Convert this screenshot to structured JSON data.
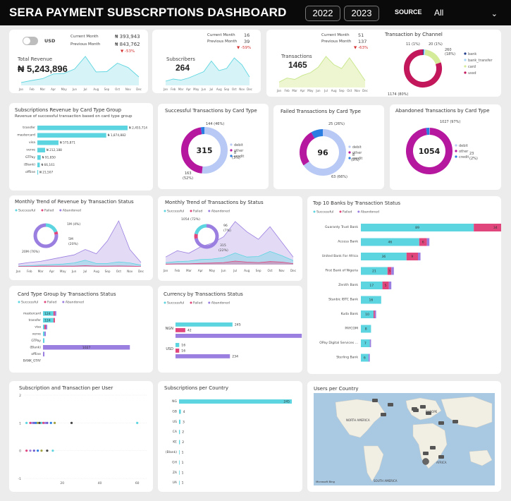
{
  "header": {
    "title": "SERA PAYMENT SUBSCRPTIONS DASHBOARD",
    "years": [
      "2022",
      "2023"
    ],
    "source_label": "SOURCE",
    "source_value": "All"
  },
  "kpis": {
    "currency_toggle_label": "USD",
    "revenue": {
      "label": "Total Revenue",
      "value": "₦ 5,243,896",
      "current_label": "Current Month",
      "current_value": "₦ 393,943",
      "previous_label": "Previous Month",
      "previous_value": "₦ 843,762",
      "change": "▼ -53%"
    },
    "subscribers": {
      "label": "Subscribers",
      "value": "264",
      "current_label": "Current Month",
      "current_value": "16",
      "previous_label": "Previous Month",
      "previous_value": "39",
      "change": "▼ -59%"
    },
    "transactions": {
      "label": "Transactions",
      "value": "1465",
      "current_label": "Current Month",
      "current_value": "51",
      "previous_label": "Previous Month",
      "previous_value": "137",
      "change": "▼ -63%"
    },
    "months": [
      "Jan",
      "Feb",
      "Mar",
      "Apr",
      "May",
      "Jun",
      "Jul",
      "Aug",
      "Sep",
      "Oct",
      "Nov",
      "Dec"
    ]
  },
  "colors": {
    "successful": "#5dd5e0",
    "failed": "#e0457b",
    "abandoned": "#9b7fe0",
    "bank": "#1e3a8a",
    "bank_transfer": "#a7d8f5",
    "card": "#d4ec9a",
    "ussd": "#c2185b",
    "debit": "#b8c9f5",
    "other": "#b5179e",
    "credit": "#2a7de1"
  },
  "chart_data": [
    {
      "id": "revenue_trend",
      "type": "area",
      "categories": [
        "Jan",
        "Feb",
        "Mar",
        "Apr",
        "May",
        "Jun",
        "Jul",
        "Aug",
        "Sep",
        "Oct",
        "Nov",
        "Dec"
      ],
      "values": [
        100,
        170,
        230,
        390,
        410,
        560,
        990,
        460,
        470,
        760,
        610,
        290
      ]
    },
    {
      "id": "subscribers_trend",
      "type": "area",
      "categories": [
        "Jan",
        "Feb",
        "Mar",
        "Apr",
        "May",
        "Jun",
        "Jul",
        "Aug",
        "Sep",
        "Oct",
        "Nov",
        "Dec"
      ],
      "values": [
        8,
        12,
        10,
        14,
        20,
        26,
        46,
        28,
        32,
        52,
        39,
        16
      ]
    },
    {
      "id": "transactions_trend",
      "type": "area",
      "categories": [
        "Jan",
        "Feb",
        "Mar",
        "Apr",
        "May",
        "Jun",
        "Jul",
        "Aug",
        "Sep",
        "Oct",
        "Nov",
        "Dec"
      ],
      "values": [
        40,
        70,
        60,
        90,
        110,
        150,
        230,
        170,
        140,
        220,
        137,
        51
      ]
    },
    {
      "id": "transactions_by_channel",
      "type": "pie",
      "title": "Transaction by Channel",
      "labels": [
        "bank",
        "bank_transfer",
        "card",
        "ussd"
      ],
      "values": [
        11,
        20,
        260,
        1174
      ],
      "data_labels": [
        "11 (1%)",
        "20 (1%)",
        "260 (18%)",
        "1174 (80%)"
      ]
    },
    {
      "id": "revenue_by_card_type",
      "type": "bar",
      "title": "Subscriptions Revenue by Card Type Group",
      "subtitle": "Revenue of successful transaction based on card type group",
      "categories": [
        "transfer",
        "mastercard",
        "visa",
        "verve",
        "GTPay",
        "(Blank)",
        "offline"
      ],
      "values": [
        2455714,
        1874882,
        575871,
        212188,
        91850,
        66161,
        21507
      ],
      "data_labels": [
        "₦ 2,455,714",
        "₦ 1,874,882",
        "₦ 575,871",
        "₦ 212,188",
        "₦ 91,850",
        "₦ 66,161",
        "₦ 21,507"
      ]
    },
    {
      "id": "successful_by_card",
      "type": "pie",
      "title": "Successful Transactions by Card Type",
      "total": "315",
      "labels": [
        "debit",
        "other",
        "credit"
      ],
      "values": [
        163,
        144,
        8
      ],
      "data_labels": [
        "163 (52%)",
        "144 (46%)",
        "8 (3%)"
      ]
    },
    {
      "id": "failed_by_card",
      "type": "pie",
      "title": "Failed Transactions by Card Type",
      "total": "96",
      "labels": [
        "debit",
        "other",
        "credit"
      ],
      "values": [
        63,
        25,
        8
      ],
      "data_labels": [
        "63 (66%)",
        "25 (26%)",
        "8 (8%)"
      ]
    },
    {
      "id": "abandoned_by_card",
      "type": "pie",
      "title": "Abandoned Transactions by Card Type",
      "total": "1054",
      "labels": [
        "debit",
        "other",
        "credit"
      ],
      "values": [
        4,
        1027,
        23
      ],
      "data_labels": [
        "1027 (97%)",
        "23 (2%)"
      ]
    },
    {
      "id": "revenue_trend_by_status",
      "type": "area",
      "title": "Monthly Trend of Revenue by Transaction Status",
      "categories": [
        "Jan",
        "Feb",
        "Mar",
        "Apr",
        "May",
        "Jun",
        "Jul",
        "Aug",
        "Sep",
        "Oct",
        "Nov",
        "Dec"
      ],
      "series": [
        {
          "name": "Successful",
          "values": [
            0.1,
            0.2,
            0.3,
            0.4,
            0.5,
            0.7,
            1.2,
            0.6,
            0.6,
            0.9,
            0.7,
            0.3
          ]
        },
        {
          "name": "Failed",
          "values": [
            0.05,
            0.05,
            0.1,
            0.1,
            0.1,
            0.1,
            0.2,
            0.1,
            0.1,
            0.15,
            0.1,
            0.05
          ]
        },
        {
          "name": "Abandoned",
          "values": [
            0.5,
            0.8,
            1.0,
            1.4,
            1.8,
            2.2,
            3.2,
            2.4,
            4.8,
            8.5,
            3.2,
            0.8
          ]
        }
      ],
      "donut": {
        "labels": [
          "Successful",
          "Failed",
          "Abandoned"
        ],
        "values": [
          5,
          1,
          20
        ],
        "data_labels": [
          "5M (20%)",
          "1M (4%)",
          "20M (76%)"
        ]
      }
    },
    {
      "id": "transactions_trend_by_status",
      "type": "area",
      "title": "Monthly Trend of Transactions by Status",
      "categories": [
        "Jan",
        "Feb",
        "Mar",
        "Apr",
        "May",
        "Jun",
        "Jul",
        "Aug",
        "Sep",
        "Oct",
        "Nov",
        "Dec"
      ],
      "series": [
        {
          "name": "Successful",
          "values": [
            8,
            12,
            14,
            20,
            22,
            28,
            46,
            30,
            32,
            52,
            36,
            16
          ]
        },
        {
          "name": "Failed",
          "values": [
            2,
            3,
            3,
            5,
            6,
            8,
            14,
            10,
            8,
            12,
            10,
            4
          ]
        },
        {
          "name": "Abandoned",
          "values": [
            30,
            55,
            45,
            70,
            85,
            110,
            170,
            130,
            100,
            150,
            90,
            30
          ]
        }
      ],
      "donut": {
        "labels": [
          "Abandoned",
          "Failed",
          "Successful"
        ],
        "values": [
          1054,
          96,
          315
        ],
        "data_labels": [
          "1054 (72%)",
          "96 (7%)",
          "315 (22%)"
        ]
      }
    },
    {
      "id": "top_banks",
      "type": "bar",
      "title": "Top 10 Banks by Transaction Status",
      "categories": [
        "Guaranty Trust Bank",
        "Access Bank",
        "United Bank For Africa",
        "First Bank of Nigeria",
        "Zenith Bank",
        "Stanbic IBTC Bank",
        "Kuda Bank",
        "PAYCOM",
        "OPay Digital Services ...",
        "Sterling Bank"
      ],
      "series": [
        {
          "name": "Successful",
          "values": [
            89,
            46,
            36,
            21,
            17,
            16,
            10,
            8,
            7,
            6
          ]
        },
        {
          "name": "Failed",
          "values": [
            34,
            6,
            9,
            3,
            5,
            0,
            1,
            0,
            0,
            0
          ]
        },
        {
          "name": "Abandoned",
          "values": [
            6,
            2,
            2,
            2,
            2,
            0,
            1,
            0,
            1,
            1
          ]
        }
      ],
      "data_labels": [
        [
          "89",
          "34",
          "6"
        ],
        [
          "46",
          "6",
          ""
        ],
        [
          "36",
          "9",
          ""
        ],
        [
          "21",
          "3",
          ""
        ],
        [
          "17",
          "5",
          ""
        ],
        [
          "16",
          "",
          ""
        ],
        [
          "10",
          "",
          ""
        ],
        [
          "8",
          "",
          ""
        ],
        [
          "7",
          "",
          ""
        ],
        [
          "6",
          "",
          ""
        ]
      ]
    },
    {
      "id": "card_type_by_status",
      "type": "bar",
      "title": "Card Type Group by Transactions Status",
      "categories": [
        "mastercard",
        "transfer",
        "visa",
        "verve",
        "GTPay",
        "(Blank)",
        "offline",
        "BANK_GTAY"
      ],
      "series": [
        {
          "name": "Successful",
          "values": [
            124,
            124,
            10,
            3,
            1,
            0,
            0,
            0
          ]
        },
        {
          "name": "Failed",
          "values": [
            8,
            3,
            1,
            0,
            0,
            0,
            0,
            0
          ]
        },
        {
          "name": "Abandoned",
          "values": [
            14,
            0,
            2,
            1,
            0,
            1027,
            1,
            0
          ]
        }
      ],
      "data_labels": [
        "124",
        "124",
        "",
        "",
        "",
        "1027",
        "",
        ""
      ]
    },
    {
      "id": "currency_by_status",
      "type": "bar",
      "title": "Currency by Transactions Status",
      "categories": [
        "NGN",
        "USD"
      ],
      "series": [
        {
          "name": "Successful",
          "values": [
            245,
            16
          ]
        },
        {
          "name": "Failed",
          "values": [
            42,
            16
          ]
        },
        {
          "name": "Abandoned",
          "values": [
            543,
            234
          ]
        }
      ]
    },
    {
      "id": "subs_per_user",
      "type": "scatter",
      "title": "Subscription and Transaction per User",
      "ylim": [
        -1,
        2
      ],
      "xlim": [
        0,
        65
      ],
      "yticks": [
        "2",
        "1",
        "0",
        "-1"
      ],
      "xticks": [
        "20",
        "40",
        "60"
      ],
      "points": [
        [
          1,
          1
        ],
        [
          3,
          1
        ],
        [
          4,
          1
        ],
        [
          5,
          1
        ],
        [
          6,
          1
        ],
        [
          7,
          1
        ],
        [
          8,
          1
        ],
        [
          9,
          1
        ],
        [
          10,
          1
        ],
        [
          11,
          1
        ],
        [
          12,
          1
        ],
        [
          14,
          1
        ],
        [
          16,
          1
        ],
        [
          25,
          1
        ],
        [
          60,
          1
        ],
        [
          1,
          0
        ],
        [
          3,
          0
        ],
        [
          5,
          0
        ],
        [
          7,
          0
        ],
        [
          9,
          0
        ],
        [
          12,
          0
        ],
        [
          15,
          0
        ]
      ]
    },
    {
      "id": "subs_per_country",
      "type": "bar",
      "title": "Subscriptions per Country",
      "categories": [
        "NG",
        "GB",
        "US",
        "CA",
        "KE",
        "(Blank)",
        "GH",
        "ZA",
        "UA"
      ],
      "values": [
        245,
        4,
        3,
        2,
        2,
        1,
        1,
        1,
        1
      ],
      "data_labels": [
        "245",
        "4",
        "3",
        "2",
        "2",
        "1",
        "1",
        "1",
        "1"
      ]
    },
    {
      "id": "users_per_country",
      "type": "map",
      "title": "Users per Country",
      "labels": [
        "NORTH AMERICA",
        "EUROPE",
        "AFRICA",
        "SOUTH AMERICA"
      ],
      "credit": "Microsoft Bing"
    }
  ],
  "legend": {
    "successful": "Successful",
    "failed": "Failed",
    "abandoned": "Abandoned"
  }
}
